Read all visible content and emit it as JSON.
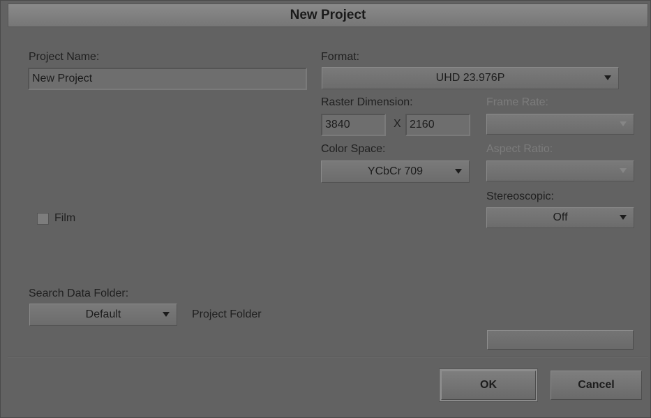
{
  "dialog": {
    "title": "New Project"
  },
  "project_name": {
    "label": "Project Name:",
    "value": "New Project"
  },
  "format": {
    "label": "Format:",
    "value": "UHD 23.976P"
  },
  "raster": {
    "label": "Raster Dimension:",
    "width": "3840",
    "separator": "X",
    "height": "2160"
  },
  "frame_rate": {
    "label": "Frame Rate:",
    "value": "",
    "disabled": true
  },
  "color_space": {
    "label": "Color Space:",
    "value": "YCbCr 709"
  },
  "aspect_ratio": {
    "label": "Aspect Ratio:",
    "value": "",
    "disabled": true
  },
  "stereoscopic": {
    "label": "Stereoscopic:",
    "value": "Off"
  },
  "film": {
    "label": "Film",
    "checked": false
  },
  "search_data_folder": {
    "label": "Search Data Folder:",
    "value": "Default",
    "folder_text": "Project Folder"
  },
  "disabled_button": {
    "label": ""
  },
  "buttons": {
    "ok": "OK",
    "cancel": "Cancel"
  }
}
